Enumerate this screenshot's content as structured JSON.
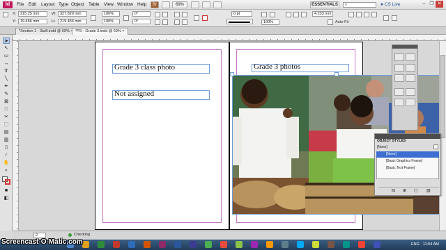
{
  "app": {
    "logo": "Id"
  },
  "menubar": {
    "items": [
      "File",
      "Edit",
      "Layout",
      "Type",
      "Object",
      "Table",
      "View",
      "Window",
      "Help"
    ],
    "bridge": "Br",
    "zoom": "69%",
    "workspace": "ESSENTIALS",
    "search_placeholder": "",
    "cslive": "CS Live"
  },
  "controlbar": {
    "x": "215.25 mm",
    "y": "19.456 mm",
    "w": "327.829 mm",
    "h": "219.456 mm",
    "scale_x": "100%",
    "scale_y": "100%",
    "scale_x2": "100%",
    "scale_y2": "100%",
    "rotate": "0°",
    "shear": "0°",
    "stroke_weight": "0 pt",
    "width_field": "4.233 mm",
    "autofit": "Auto-Fit",
    "frame_pct": "100%"
  },
  "tabs": [
    {
      "label": "*Section 1 - Staff.indd @ 69%"
    },
    {
      "label": "*PS - Grade 3.indd @ 69%"
    }
  ],
  "pages": {
    "left": {
      "frame1": "Grade 3 class photo",
      "frame2": "Not assigned"
    },
    "right": {
      "frame1": "Grade 3 photos"
    }
  },
  "object_styles": {
    "title": "OBJECT STYLES",
    "none_label": "[None]",
    "items": [
      "[None]",
      "[Basic Graphics Frame]",
      "[Basic Text Frame]"
    ],
    "selected": 0
  },
  "statusbar": {
    "page": "2",
    "preflight": "Checking"
  },
  "taskbar": {
    "lang": "ENG",
    "time": "11:54 AM"
  },
  "watermark": "Screencast-O-Matic.com",
  "colors": {
    "accent": "#c2185b",
    "selection": "#3c6fcf",
    "frame": "#6d9cd4",
    "margin": "#c678c6"
  }
}
